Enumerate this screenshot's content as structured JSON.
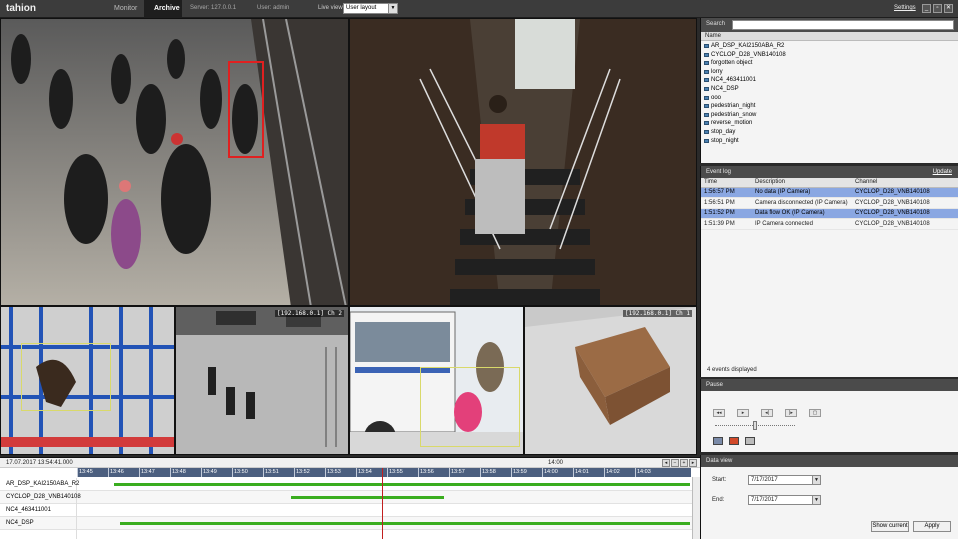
{
  "topbar": {
    "logo": "tahion",
    "tabs": [
      {
        "label": "Monitor"
      },
      {
        "label": "Archive"
      }
    ],
    "server": "Server: 127.0.0.1",
    "user": "User: admin",
    "live_view_label": "Live view:",
    "layout_value": "User layout",
    "settings": "Settings",
    "window_buttons": [
      "_",
      "▫",
      "✕"
    ]
  },
  "cameras": [
    {
      "name": "cam-platform",
      "label": ""
    },
    {
      "name": "cam-staircase",
      "label": ""
    },
    {
      "name": "cam-fence",
      "label": ""
    },
    {
      "name": "cam-street",
      "label": "[192.168.0.1] Ch 2"
    },
    {
      "name": "cam-bus",
      "label": ""
    },
    {
      "name": "cam-box",
      "label": "[192.168.0.1] Ch 1"
    }
  ],
  "search": {
    "label": "Search",
    "placeholder": "",
    "column": "Name",
    "items": [
      "AR_DSP_KAI2150ABA_R2",
      "CYCLOP_D28_VNB140108",
      "forgotten object",
      "lorry",
      "NC4_463411001",
      "NC4_DSP",
      "ooo",
      "pedestrian_night",
      "pedestrian_snow",
      "reverse_motion",
      "stop_day",
      "stop_night"
    ]
  },
  "event_log": {
    "title": "Event log",
    "update": "Update",
    "columns": [
      "Time",
      "Description",
      "Channel"
    ],
    "rows": [
      {
        "time": "1:56:57 PM",
        "description": "No data (IP Camera)",
        "channel": "CYCLOP_D28_VNB140108",
        "selected": true
      },
      {
        "time": "1:56:51 PM",
        "description": "Camera disconnected (IP Camera)",
        "channel": "CYCLOP_D28_VNB140108",
        "selected": false
      },
      {
        "time": "1:51:52 PM",
        "description": "Data flow OK (IP Camera)",
        "channel": "CYCLOP_D28_VNB140108",
        "selected": true
      },
      {
        "time": "1:51:39 PM",
        "description": "IP Camera connected",
        "channel": "CYCLOP_D28_VNB140108",
        "selected": false
      }
    ],
    "footer": "4 events displayed"
  },
  "pause": {
    "title": "Pause",
    "controls": [
      "◂◂",
      "▸",
      "◂|",
      "|▸",
      "▢"
    ]
  },
  "data_view": {
    "title": "Data view",
    "start_label": "Start:",
    "start_value": "7/17/2017",
    "end_label": "End:",
    "end_value": "7/17/2017",
    "show_current": "Show current",
    "apply": "Apply"
  },
  "timeline": {
    "date": "17.07.2017 13:54:41.000",
    "marker": "14:00",
    "ticks": [
      "13:45",
      "13:46",
      "13:47",
      "13:48",
      "13:49",
      "13:50",
      "13:51",
      "13:52",
      "13:53",
      "13:54",
      "13:55",
      "13:56",
      "13:57",
      "13:58",
      "13:59",
      "14:00",
      "14:01",
      "14:02",
      "14:03"
    ],
    "rows": [
      {
        "name": "AR_DSP_KAI2150ABA_R2"
      },
      {
        "name": "CYCLOP_D28_VNB140108"
      },
      {
        "name": "NC4_463411001"
      },
      {
        "name": "NC4_DSP"
      },
      {
        "name": ""
      }
    ],
    "controls": [
      "◂",
      "−",
      "+",
      "▸"
    ]
  },
  "colors": {
    "accent_selection": "#8aa7e2",
    "timeline_segment": "#3aad1f",
    "playhead": "#c21f1f",
    "detection_box": "#e02020"
  }
}
